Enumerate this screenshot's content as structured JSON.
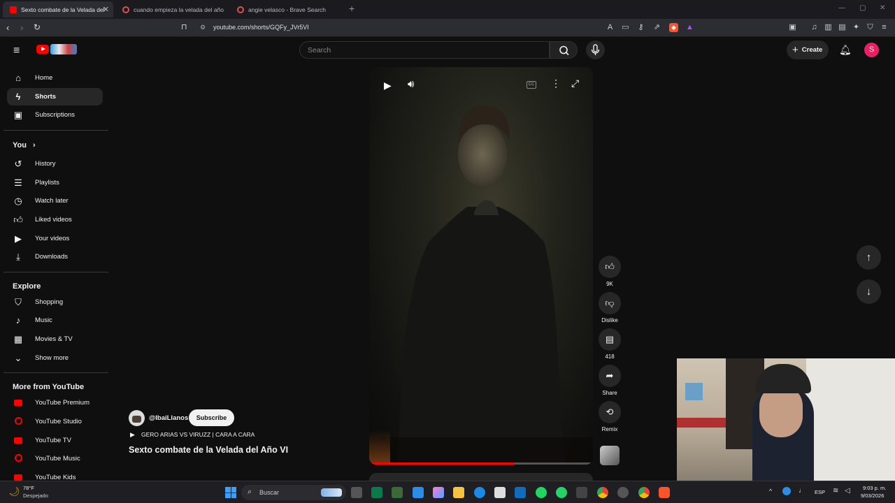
{
  "browser": {
    "tabs": [
      {
        "title": "Sexto combate de la Velada del",
        "active": true
      },
      {
        "title": "cuando empieza la velada del año - ",
        "active": false
      },
      {
        "title": "angie velasco - Brave Search",
        "active": false
      }
    ],
    "new_tab": "+",
    "url": "youtube.com/shorts/GQFy_JVr5VI"
  },
  "youtube": {
    "search_placeholder": "Search",
    "create_label": "Create",
    "avatar_letter": "S",
    "sidebar": {
      "main": [
        {
          "label": "Home",
          "icon": "home-icon"
        },
        {
          "label": "Shorts",
          "icon": "shorts-icon"
        },
        {
          "label": "Subscriptions",
          "icon": "subscriptions-icon"
        }
      ],
      "you_heading": "You",
      "you": [
        {
          "label": "History",
          "icon": "history-icon"
        },
        {
          "label": "Playlists",
          "icon": "playlists-icon"
        },
        {
          "label": "Watch later",
          "icon": "clock-icon"
        },
        {
          "label": "Liked videos",
          "icon": "like-icon"
        },
        {
          "label": "Your videos",
          "icon": "video-icon"
        },
        {
          "label": "Downloads",
          "icon": "download-icon"
        }
      ],
      "explore_heading": "Explore",
      "explore": [
        {
          "label": "Shopping",
          "icon": "bag-icon"
        },
        {
          "label": "Music",
          "icon": "music-icon"
        },
        {
          "label": "Movies & TV",
          "icon": "film-icon"
        },
        {
          "label": "Show more",
          "icon": "chevron-down-icon"
        }
      ],
      "more_heading": "More from YouTube",
      "more": [
        {
          "label": "YouTube Premium"
        },
        {
          "label": "YouTube Studio"
        },
        {
          "label": "YouTube TV"
        },
        {
          "label": "YouTube Music"
        },
        {
          "label": "YouTube Kids"
        }
      ]
    },
    "short": {
      "channel": "@IbaiLlanos",
      "subscribe": "Subscribe",
      "music_title": "GERO ARIAS VS VIRUZZ | CARA A CARA",
      "title": "Sexto combate de la Velada del Año VI",
      "likes": "9K",
      "dislike": "Dislike",
      "comments": "418",
      "share": "Share",
      "remix": "Remix",
      "progress": 0.65
    }
  },
  "taskbar": {
    "weather_temp": "78°F",
    "weather_desc": "Despejado",
    "search_label": "Buscar",
    "lang": "ESP",
    "time": "9:03 p. m.",
    "date": "9/03/2026"
  },
  "colors": {
    "youtube_red": "#ff0000",
    "brave_orange": "#fb542b",
    "avatar_pink": "#e91e63"
  }
}
